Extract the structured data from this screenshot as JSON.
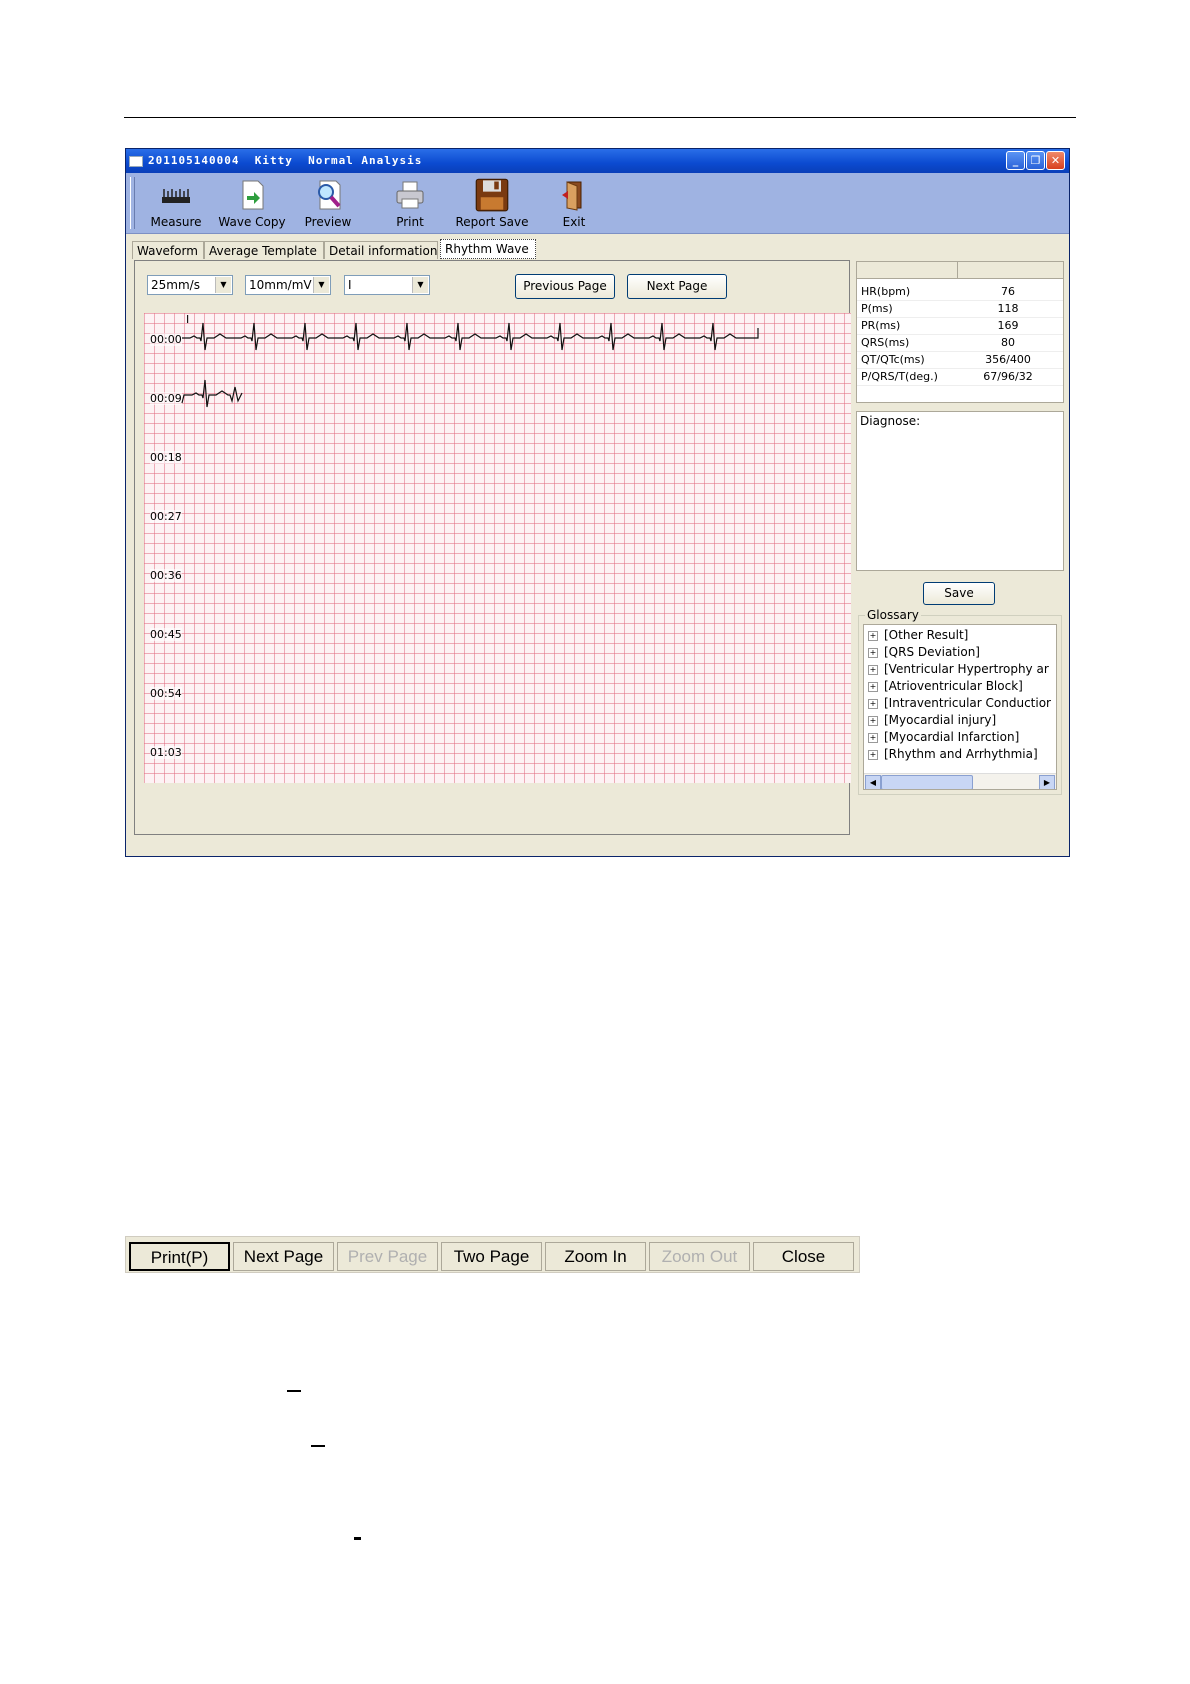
{
  "window": {
    "title": "201105140004  Kitty  Normal Analysis",
    "controls": [
      "_",
      "❐",
      "✕"
    ]
  },
  "toolbar": [
    {
      "label": "Measure",
      "icon": "ruler-icon"
    },
    {
      "label": "Wave Copy",
      "icon": "copy-page-icon"
    },
    {
      "label": "Preview",
      "icon": "magnifier-icon"
    },
    {
      "label": "Print",
      "icon": "printer-icon"
    },
    {
      "label": "Report Save",
      "icon": "floppy-disk-icon"
    },
    {
      "label": "Exit",
      "icon": "exit-door-icon"
    }
  ],
  "tabs": [
    {
      "label": "Waveform"
    },
    {
      "label": "Average Template"
    },
    {
      "label": "Detail information"
    },
    {
      "label": "Rhythm Wave",
      "active": true
    }
  ],
  "controls": {
    "speed": "25mm/s",
    "gain": "10mm/mV",
    "lead": "I",
    "previous_page": "Previous Page",
    "next_page": "Next Page"
  },
  "ecg": {
    "lead_label": "I",
    "time_labels": [
      "00:00",
      "00:09",
      "00:18",
      "00:27",
      "00:36",
      "00:45",
      "00:54",
      "01:03"
    ]
  },
  "measurements": [
    {
      "key": "HR(bpm)",
      "value": "76"
    },
    {
      "key": "P(ms)",
      "value": "118"
    },
    {
      "key": "PR(ms)",
      "value": "169"
    },
    {
      "key": "QRS(ms)",
      "value": "80"
    },
    {
      "key": "QT/QTc(ms)",
      "value": "356/400"
    },
    {
      "key": "P/QRS/T(deg.)",
      "value": "67/96/32"
    }
  ],
  "diagnose": {
    "label": "Diagnose:",
    "save": "Save"
  },
  "glossary": {
    "label": "Glossary",
    "items": [
      "[Other Result]",
      "[QRS Deviation]",
      "[Ventricular Hypertrophy ar",
      "[Atrioventricular Block]",
      "[Intraventricular Conductior",
      "[Myocardial injury]",
      "[Myocardial Infarction]",
      "[Rhythm and Arrhythmia]"
    ]
  },
  "preview_toolbar": [
    {
      "label": "Print(P)",
      "enabled": true
    },
    {
      "label": "Next Page",
      "enabled": true
    },
    {
      "label": "Prev Page",
      "enabled": false
    },
    {
      "label": "Two Page",
      "enabled": true
    },
    {
      "label": "Zoom In",
      "enabled": true
    },
    {
      "label": "Zoom Out",
      "enabled": false
    },
    {
      "label": "Close",
      "enabled": true
    }
  ]
}
